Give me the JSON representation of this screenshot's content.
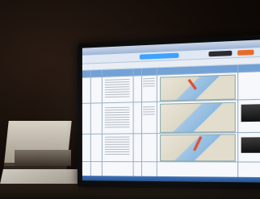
{
  "scene": {
    "description_colors": {
      "background": "#120b07",
      "screen": "#eef3f8",
      "accent_blue": "#3aa0ff",
      "header_blue": "#6fa0d6",
      "route_red": "#e04a2a"
    }
  },
  "icons": {
    "monitor": "monitor-icon",
    "map": "map-icon"
  }
}
